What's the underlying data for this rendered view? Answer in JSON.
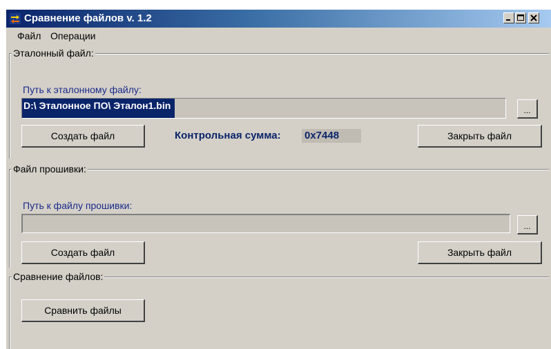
{
  "window": {
    "title": "Сравнение файлов v. 1.2"
  },
  "menu": {
    "items": [
      "Файл",
      "Операции"
    ]
  },
  "reference_group": {
    "legend": "Эталонный файл:",
    "path_label": "Путь к эталонному файлу:",
    "path_value": "D:\\ Эталонное ПО\\ Эталон1.bin",
    "browse_label": "...",
    "create_label": "Создать файл",
    "checksum_label": "Контрольная сумма:",
    "checksum_value": "0x7448",
    "close_label": "Закрыть файл"
  },
  "firmware_group": {
    "legend": "Файл прошивки:",
    "path_label": "Путь к файлу прошивки:",
    "path_value": "",
    "browse_label": "...",
    "create_label": "Создать файл",
    "close_label": "Закрыть файл"
  },
  "compare_group": {
    "legend": "Сравнение файлов:",
    "compare_label": "Сравнить файлы"
  },
  "colors": {
    "title_start": "#0a246a",
    "title_end": "#a6caf0",
    "window_bg": "#d4d0c8",
    "label_blue": "#1a2a8a",
    "selection": "#0a246a"
  },
  "icons": {
    "app": "compare-arrows-icon",
    "minimize": "minimize-icon",
    "maximize": "maximize-icon",
    "close": "close-icon"
  }
}
